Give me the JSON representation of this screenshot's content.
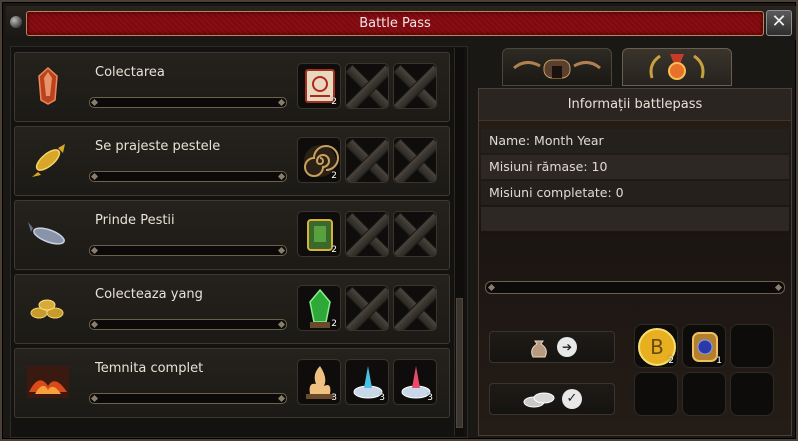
{
  "window": {
    "title": "Battle Pass",
    "close_label": "✕"
  },
  "missions": [
    {
      "name": "Colectarea",
      "icon": "red-crystal-icon",
      "progress": 0,
      "rewards": [
        {
          "icon": "scroll-icon",
          "count": "2",
          "locked": false
        },
        {
          "icon": "locked-slot-icon",
          "count": "",
          "locked": true
        },
        {
          "icon": "locked-slot-icon",
          "count": "",
          "locked": true
        }
      ]
    },
    {
      "name": "Se prajeste pestele",
      "icon": "golden-fish-icon",
      "progress": 0,
      "rewards": [
        {
          "icon": "swirl-icon",
          "count": "2",
          "locked": false
        },
        {
          "icon": "locked-slot-icon",
          "count": "",
          "locked": true
        },
        {
          "icon": "locked-slot-icon",
          "count": "",
          "locked": true
        }
      ]
    },
    {
      "name": "Prinde Pestii",
      "icon": "blue-fish-icon",
      "progress": 0,
      "rewards": [
        {
          "icon": "green-armor-icon",
          "count": "2",
          "locked": false
        },
        {
          "icon": "locked-slot-icon",
          "count": "",
          "locked": true
        },
        {
          "icon": "locked-slot-icon",
          "count": "",
          "locked": true
        }
      ]
    },
    {
      "name": "Colecteaza yang",
      "icon": "gold-coins-icon",
      "progress": 0,
      "rewards": [
        {
          "icon": "green-crystal-icon",
          "count": "2",
          "locked": false
        },
        {
          "icon": "locked-slot-icon",
          "count": "",
          "locked": true
        },
        {
          "icon": "locked-slot-icon",
          "count": "",
          "locked": true
        }
      ]
    },
    {
      "name": "Temnita complet",
      "icon": "dungeon-fire-icon",
      "progress": 0,
      "rewards": [
        {
          "icon": "campfire-icon",
          "count": "3",
          "locked": false
        },
        {
          "icon": "blue-fountain-icon",
          "count": "3",
          "locked": false
        },
        {
          "icon": "red-fountain-icon",
          "count": "3",
          "locked": false
        }
      ]
    }
  ],
  "tabs": [
    {
      "name": "tab-missions",
      "icon": "gate-icon",
      "active": false
    },
    {
      "name": "tab-info",
      "icon": "medal-icon",
      "active": true
    }
  ],
  "info": {
    "header": "Informații battlepass",
    "name_line": "Name: Month Year",
    "remaining_line": "Misiuni rămase: 10",
    "completed_line": "Misiuni completate: 0",
    "progress": 0
  },
  "actions": [
    {
      "name": "send-pouch-button",
      "icon": "pouch-icon",
      "symbol": "➔"
    },
    {
      "name": "confirm-coins-button",
      "icon": "coins-icon",
      "symbol": "✓"
    }
  ],
  "final_rewards": [
    {
      "icon": "gold-b-coin-icon",
      "label": "B",
      "count": "2"
    },
    {
      "icon": "blue-ring-icon",
      "label": "",
      "count": "1"
    },
    {
      "icon": "",
      "label": "",
      "count": ""
    },
    {
      "icon": "",
      "label": "",
      "count": ""
    },
    {
      "icon": "",
      "label": "",
      "count": ""
    },
    {
      "icon": "",
      "label": "",
      "count": ""
    }
  ],
  "colors": {
    "title_bar": "#8a0d12",
    "progress_fill": "#c9a24a",
    "text": "#e8e2d6"
  }
}
